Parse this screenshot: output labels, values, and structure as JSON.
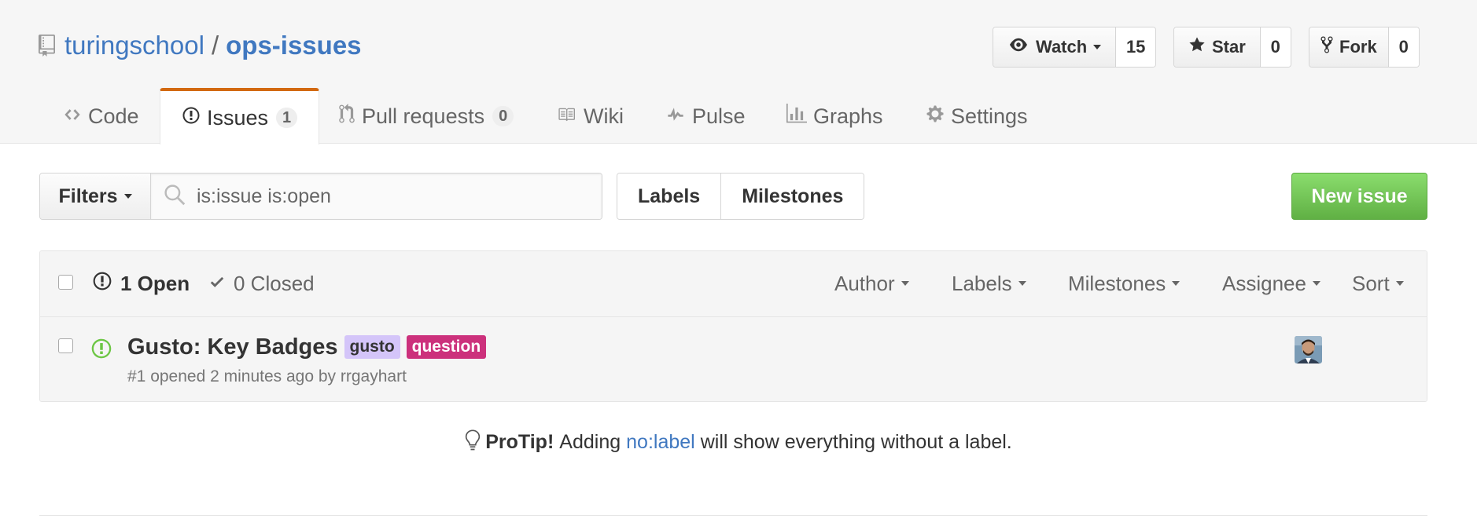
{
  "repo": {
    "owner": "turingschool",
    "separator": "/",
    "name": "ops-issues",
    "icon": "repo-icon"
  },
  "pagehead_actions": {
    "watch": {
      "label": "Watch",
      "count": "15",
      "icon": "eye-icon"
    },
    "star": {
      "label": "Star",
      "count": "0",
      "icon": "star-icon"
    },
    "fork": {
      "label": "Fork",
      "count": "0",
      "icon": "repo-forked-icon"
    }
  },
  "tabs": [
    {
      "label": "Code",
      "icon": "code-icon"
    },
    {
      "label": "Issues",
      "counter": "1",
      "icon": "issue-opened-icon",
      "selected": true
    },
    {
      "label": "Pull requests",
      "counter": "0",
      "icon": "git-pull-request-icon"
    },
    {
      "label": "Wiki",
      "icon": "book-icon"
    },
    {
      "label": "Pulse",
      "icon": "pulse-icon"
    },
    {
      "label": "Graphs",
      "icon": "graph-icon"
    },
    {
      "label": "Settings",
      "icon": "gear-icon"
    }
  ],
  "toolbar": {
    "filters_label": "Filters",
    "search_value": "is:issue is:open",
    "labels_label": "Labels",
    "milestones_label": "Milestones",
    "new_issue_label": "New issue"
  },
  "listing": {
    "open_label": "1 Open",
    "closed_label": "0 Closed",
    "selects": [
      "Author",
      "Labels",
      "Milestones",
      "Assignee",
      "Sort"
    ]
  },
  "issues": [
    {
      "title": "Gusto: Key Badges",
      "labels": [
        {
          "name": "gusto",
          "bg": "#d4c5f9",
          "fg": "#333333"
        },
        {
          "name": "question",
          "bg": "#cc317c",
          "fg": "#ffffff"
        }
      ],
      "meta": "#1 opened 2 minutes ago by rrgayhart"
    }
  ],
  "protip": {
    "strong": "ProTip!",
    "before": "Adding",
    "link": "no:label",
    "after": "will show everything without a label."
  },
  "colors": {
    "link": "#4078c0",
    "selected_tab_border": "#d26911",
    "open_green": "#6cc644",
    "new_issue_green": "#60b044"
  }
}
